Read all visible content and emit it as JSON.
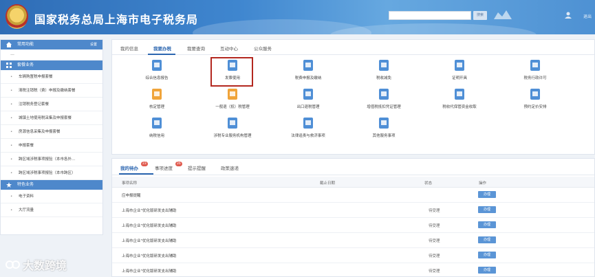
{
  "header": {
    "title": "国家税务总局上海市电子税务局",
    "search_button": "搜索",
    "logout": "退出"
  },
  "left": {
    "common_functions": {
      "title": "常用功能",
      "action": "设置"
    },
    "placeholder": "—",
    "my_business": {
      "title": "套餐业务"
    },
    "items": [
      "车辆购置税申报套餐",
      "清税注销税（费）申报及缴纳套餐",
      "注销税务登记套餐",
      "城镇土地使用税采集及申报套餐",
      "房源信息采集及申报套餐",
      "申报套餐",
      "跨区域涉税事项报验（本市各外...",
      "跨区域涉税事项报验（本市跨区）"
    ],
    "featured": {
      "title": "特色业务"
    },
    "featured_items": [
      "电子资料",
      "大厅流量"
    ]
  },
  "main": {
    "tabs": [
      "我的信息",
      "我要办税",
      "我要查询",
      "互动中心",
      "公众服务"
    ],
    "active_tab": 1,
    "functions": [
      {
        "label": "综合信息报告",
        "icon": "report-icon",
        "color": "#4f8fd6"
      },
      {
        "label": "发票使用",
        "icon": "invoice-icon",
        "color": "#4f8fd6"
      },
      {
        "label": "税费申报及缴纳",
        "icon": "tax-declare-icon",
        "color": "#4f8fd6"
      },
      {
        "label": "税收减免",
        "icon": "tax-relief-icon",
        "color": "#4f8fd6"
      },
      {
        "label": "证明开具",
        "icon": "certificate-icon",
        "color": "#4f8fd6"
      },
      {
        "label": "税务行政许可",
        "icon": "license-icon",
        "color": "#4f8fd6"
      },
      {
        "label": "核定管理",
        "icon": "verify-icon",
        "color": "#f0a43a"
      },
      {
        "label": "一般退（抵）税管理",
        "icon": "refund-icon",
        "color": "#f0a43a"
      },
      {
        "label": "出口退税管理",
        "icon": "export-refund-icon",
        "color": "#4f8fd6"
      },
      {
        "label": "增值税抵扣凭证管理",
        "icon": "vat-icon",
        "color": "#4f8fd6"
      },
      {
        "label": "税收代保管资金收取",
        "icon": "fund-icon",
        "color": "#4f8fd6"
      },
      {
        "label": "预约定价安排",
        "icon": "pricing-icon",
        "color": "#4f8fd6"
      },
      {
        "label": "纳税信用",
        "icon": "credit-icon",
        "color": "#4f8fd6"
      },
      {
        "label": "涉税专业服务机构管理",
        "icon": "agency-icon",
        "color": "#4f8fd6"
      },
      {
        "label": "法律追责与救济事项",
        "icon": "law-icon",
        "color": "#4f8fd6"
      },
      {
        "label": "其他服务事项",
        "icon": "other-icon",
        "color": "#4f8fd6"
      }
    ]
  },
  "bottom": {
    "tabs": [
      {
        "label": "我的待办",
        "badge": "23"
      },
      {
        "label": "事项进度",
        "badge": "26"
      },
      {
        "label": "提示提醒",
        "badge": ""
      },
      {
        "label": "政策速递",
        "badge": ""
      }
    ],
    "columns": [
      "事项名称",
      "截止日期",
      "状态",
      "操作"
    ],
    "rows": [
      {
        "name": "应申报提醒",
        "status": "",
        "action": "办理"
      },
      {
        "name": "上海市企业\"优化版研发支出辅助",
        "status": "待受理",
        "action": "办理"
      },
      {
        "name": "上海市企业\"优化版研发支出辅助",
        "status": "待受理",
        "action": "办理"
      },
      {
        "name": "上海市企业\"优化版研发支出辅助",
        "status": "待受理",
        "action": "办理"
      },
      {
        "name": "上海市企业\"优化版研发支出辅助",
        "status": "待受理",
        "action": "办理"
      },
      {
        "name": "上海市企业\"优化版研发支出辅助",
        "status": "待受理",
        "action": "办理"
      }
    ]
  },
  "watermark": "大数跨境",
  "colors": {
    "header": "#3f86cf",
    "accent": "#2c66b0",
    "highlight": "#b3271f",
    "badge": "#e05a4e"
  }
}
